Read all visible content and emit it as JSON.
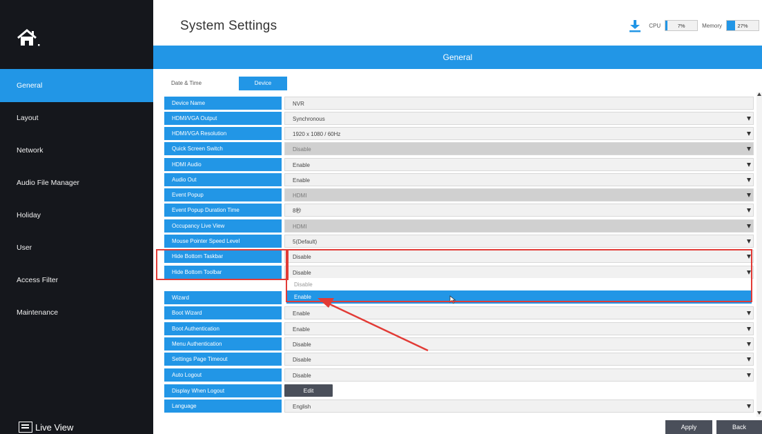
{
  "sidebar": {
    "items": [
      {
        "label": "General"
      },
      {
        "label": "Layout"
      },
      {
        "label": "Network"
      },
      {
        "label": "Audio File Manager"
      },
      {
        "label": "Holiday"
      },
      {
        "label": "User"
      },
      {
        "label": "Access Filter"
      },
      {
        "label": "Maintenance"
      }
    ],
    "live_view": "Live View"
  },
  "header": {
    "title": "System Settings",
    "cpu_label": "CPU",
    "cpu_value": "7%",
    "cpu_percent": 7,
    "memory_label": "Memory",
    "memory_value": "27%",
    "memory_percent": 27
  },
  "section_title": "General",
  "tabs": [
    {
      "label": "Date & Time"
    },
    {
      "label": "Device"
    }
  ],
  "settings": [
    {
      "label": "Device Name",
      "value": "NVR",
      "has_dropdown": false,
      "disabled": false
    },
    {
      "label": "HDMI/VGA Output",
      "value": "Synchronous",
      "has_dropdown": true,
      "disabled": false
    },
    {
      "label": "HDMI/VGA Resolution",
      "value": "1920 x 1080 / 60Hz",
      "has_dropdown": true,
      "disabled": false
    },
    {
      "label": "Quick Screen Switch",
      "value": "Disable",
      "has_dropdown": true,
      "disabled": true
    },
    {
      "label": "HDMI Audio",
      "value": "Enable",
      "has_dropdown": true,
      "disabled": false
    },
    {
      "label": "Audio Out",
      "value": "Enable",
      "has_dropdown": true,
      "disabled": false
    },
    {
      "label": "Event Popup",
      "value": "HDMI",
      "has_dropdown": true,
      "disabled": true
    },
    {
      "label": "Event Popup Duration Time",
      "value": "8秒",
      "has_dropdown": true,
      "disabled": false
    },
    {
      "label": "Occupancy Live View",
      "value": "HDMI",
      "has_dropdown": true,
      "disabled": true
    },
    {
      "label": "Mouse Pointer Speed Level",
      "value": "5(Default)",
      "has_dropdown": true,
      "disabled": false
    },
    {
      "label": "Hide Bottom Taskbar",
      "value": "Disable",
      "has_dropdown": true,
      "disabled": false
    },
    {
      "label": "Hide Bottom Toolbar",
      "value": "Disable",
      "has_dropdown": true,
      "disabled": false
    },
    {
      "label": "Wizard",
      "value": "",
      "has_dropdown": false,
      "disabled": false
    },
    {
      "label": "Boot Wizard",
      "value": "Enable",
      "has_dropdown": true,
      "disabled": false
    },
    {
      "label": "Boot Authentication",
      "value": "Enable",
      "has_dropdown": true,
      "disabled": false
    },
    {
      "label": "Menu Authentication",
      "value": "Disable",
      "has_dropdown": true,
      "disabled": false
    },
    {
      "label": "Settings Page Timeout",
      "value": "Disable",
      "has_dropdown": true,
      "disabled": false
    },
    {
      "label": "Auto Logout",
      "value": "Disable",
      "has_dropdown": true,
      "disabled": false
    },
    {
      "label": "Display When Logout",
      "value": "",
      "button": "Edit",
      "has_dropdown": false,
      "disabled": false
    },
    {
      "label": "Language",
      "value": "English",
      "has_dropdown": true,
      "disabled": false
    }
  ],
  "dropdown": {
    "options": [
      "Disable",
      "Enable"
    ],
    "highlighted": "Enable"
  },
  "footer": {
    "apply": "Apply",
    "back": "Back"
  },
  "colors": {
    "accent": "#2296e6",
    "sidebar_bg": "#15171c",
    "annotation": "#e23b36",
    "button_dark": "#4a4f5a"
  }
}
